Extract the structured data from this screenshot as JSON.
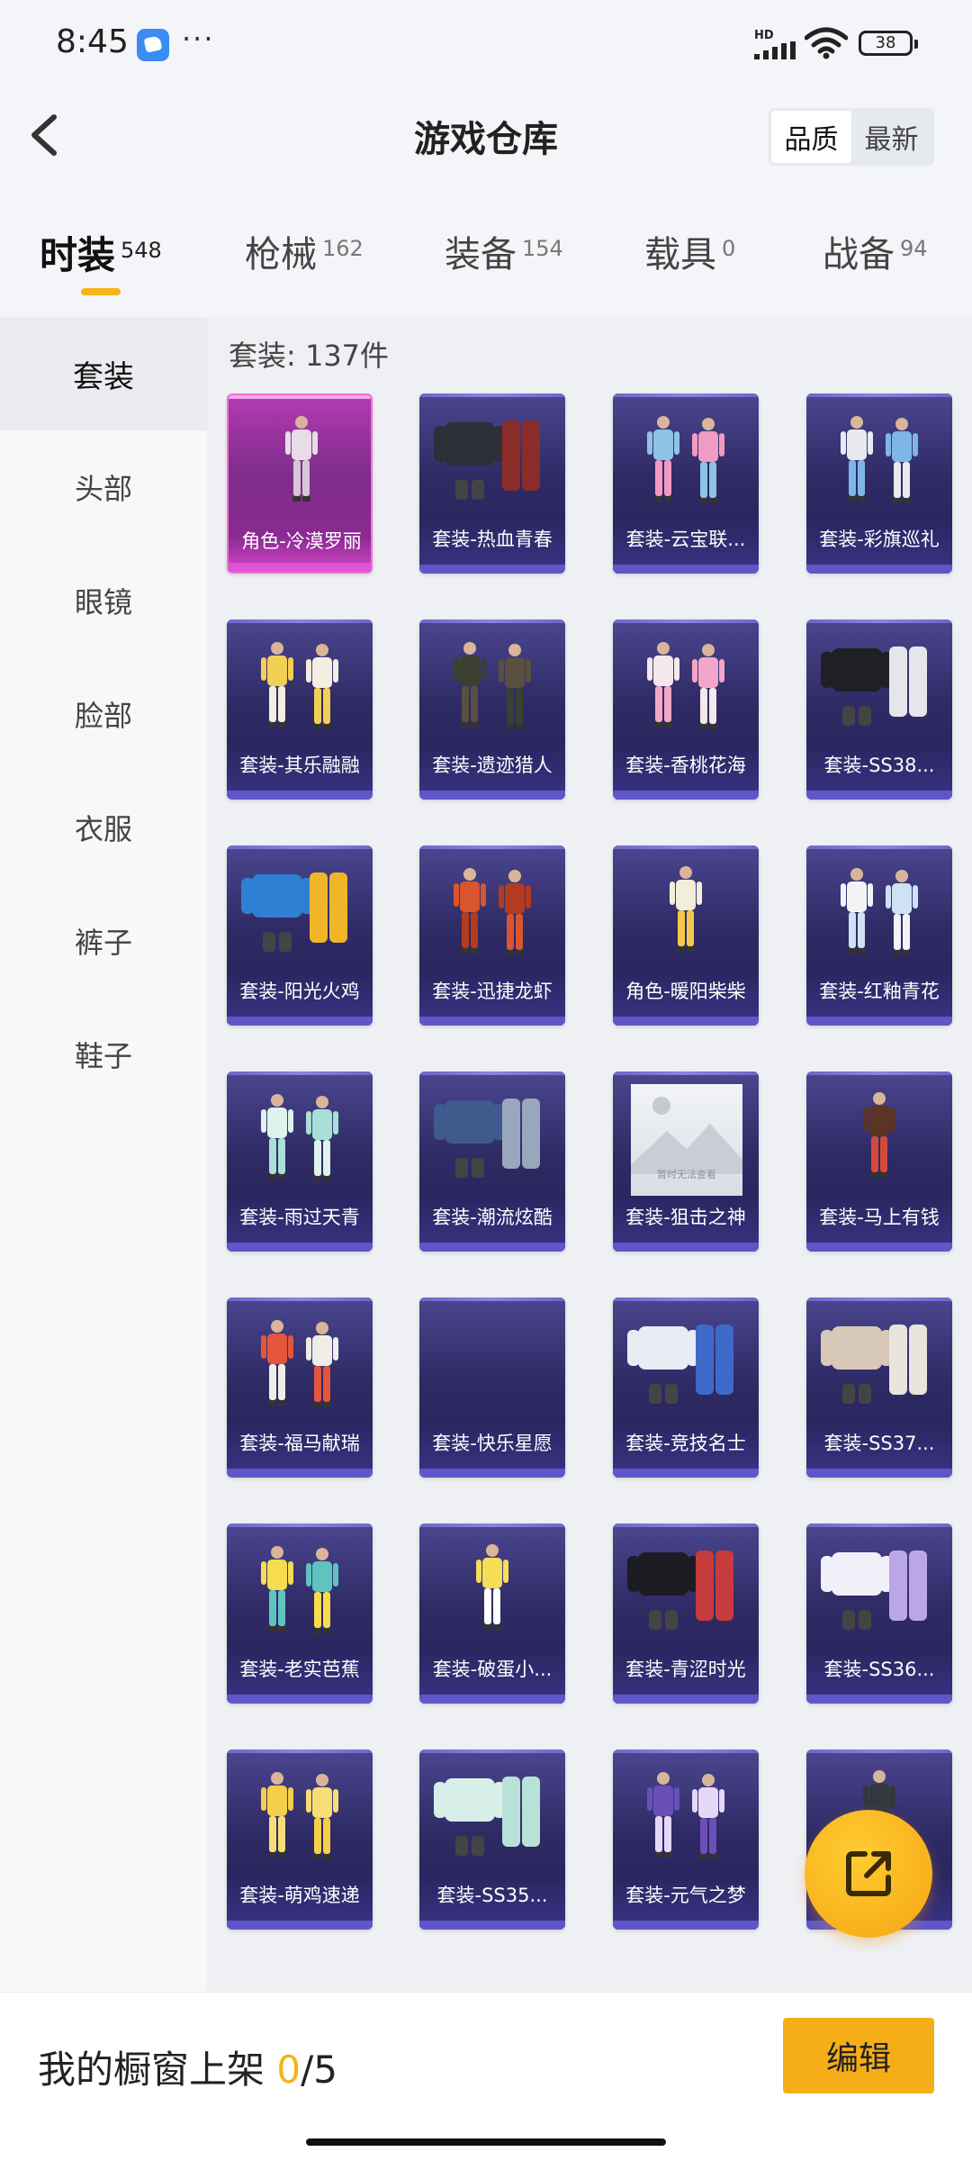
{
  "status_bar": {
    "time": "8:45",
    "more": "···",
    "network": "HD",
    "battery": "38",
    "icons": [
      "app-notification-icon",
      "signal-icon",
      "wifi-icon",
      "battery-icon"
    ]
  },
  "header": {
    "title": "游戏仓库",
    "sort_options": [
      {
        "label": "品质",
        "active": true
      },
      {
        "label": "最新",
        "active": false
      }
    ]
  },
  "tabs": [
    {
      "label": "时装",
      "count": "548",
      "active": true
    },
    {
      "label": "枪械",
      "count": "162",
      "active": false
    },
    {
      "label": "装备",
      "count": "154",
      "active": false
    },
    {
      "label": "载具",
      "count": "0",
      "active": false
    },
    {
      "label": "战备",
      "count": "94",
      "active": false
    }
  ],
  "sidebar": {
    "items": [
      {
        "label": "套装",
        "active": true
      },
      {
        "label": "头部",
        "active": false
      },
      {
        "label": "眼镜",
        "active": false
      },
      {
        "label": "脸部",
        "active": false
      },
      {
        "label": "衣服",
        "active": false
      },
      {
        "label": "裤子",
        "active": false
      },
      {
        "label": "鞋子",
        "active": false
      }
    ]
  },
  "main": {
    "count_label": "套装: 137件",
    "items": [
      {
        "label": "角色-冷漠罗丽",
        "rarity": "legendary",
        "colors": [
          "#e8dde6",
          "#d7c6d6"
        ],
        "style": "single"
      },
      {
        "label": "套装-热血青春",
        "rarity": "epic",
        "colors": [
          "#2d2f38",
          "#8a2c2a"
        ],
        "style": "outfit"
      },
      {
        "label": "套装-云宝联...",
        "rarity": "epic",
        "colors": [
          "#8ec3e6",
          "#f19ac4"
        ],
        "style": "pair"
      },
      {
        "label": "套装-彩旗巡礼",
        "rarity": "epic",
        "colors": [
          "#e9e9ef",
          "#7fb6e8"
        ],
        "style": "pair"
      },
      {
        "label": "套装-其乐融融",
        "rarity": "epic",
        "colors": [
          "#f3cf55",
          "#f3eee0"
        ],
        "style": "pair"
      },
      {
        "label": "套装-遗迹猎人",
        "rarity": "epic",
        "colors": [
          "#3b4032",
          "#59503f"
        ],
        "style": "pair"
      },
      {
        "label": "套装-香桃花海",
        "rarity": "epic",
        "colors": [
          "#f4e8ec",
          "#f4a6c8"
        ],
        "style": "pair"
      },
      {
        "label": "套装-SS38...",
        "rarity": "epic",
        "colors": [
          "#1f1f24",
          "#e6e6ea"
        ],
        "style": "outfit"
      },
      {
        "label": "套装-阳光火鸡",
        "rarity": "epic",
        "colors": [
          "#2f7fd4",
          "#f0b627"
        ],
        "style": "outfit"
      },
      {
        "label": "套装-迅捷龙虾",
        "rarity": "epic",
        "colors": [
          "#d9552f",
          "#b33b1f"
        ],
        "style": "pair"
      },
      {
        "label": "角色-暖阳柴柴",
        "rarity": "epic",
        "colors": [
          "#f2eedc",
          "#f3c94c"
        ],
        "style": "single"
      },
      {
        "label": "套装-红釉青花",
        "rarity": "epic",
        "colors": [
          "#f3f3f6",
          "#cfe1f4"
        ],
        "style": "pair"
      },
      {
        "label": "套装-雨过天青",
        "rarity": "epic",
        "colors": [
          "#dff3ee",
          "#a9e0d6"
        ],
        "style": "pair"
      },
      {
        "label": "套装-潮流炫酷",
        "rarity": "epic",
        "colors": [
          "#3f5a8d",
          "#9aa6bc"
        ],
        "style": "outfit"
      },
      {
        "label": "套装-狙击之神",
        "rarity": "epic",
        "placeholder": true,
        "placeholder_text": "暂时无法查看"
      },
      {
        "label": "套装-马上有钱",
        "rarity": "epic",
        "colors": [
          "#5a3424",
          "#d34a3a"
        ],
        "style": "single"
      },
      {
        "label": "套装-福马献瑞",
        "rarity": "epic",
        "colors": [
          "#e4553d",
          "#f0ede6"
        ],
        "style": "pair"
      },
      {
        "label": "套装-快乐星愿",
        "rarity": "epic",
        "empty": true
      },
      {
        "label": "套装-竞技名士",
        "rarity": "epic",
        "colors": [
          "#e8ecf5",
          "#3e69c9"
        ],
        "style": "outfit"
      },
      {
        "label": "套装-SS37...",
        "rarity": "epic",
        "colors": [
          "#d8c8b8",
          "#e9e4dc"
        ],
        "style": "outfit"
      },
      {
        "label": "套装-老实芭蕉",
        "rarity": "epic",
        "colors": [
          "#f6dc4e",
          "#5fc4c0"
        ],
        "style": "pair"
      },
      {
        "label": "套装-破蛋小...",
        "rarity": "epic",
        "colors": [
          "#f6de55",
          "#ffffff"
        ],
        "style": "single"
      },
      {
        "label": "套装-青涩时光",
        "rarity": "epic",
        "colors": [
          "#1c1c22",
          "#c63b3b"
        ],
        "style": "outfit"
      },
      {
        "label": "套装-SS36...",
        "rarity": "epic",
        "colors": [
          "#f1f0f8",
          "#bba6e6"
        ],
        "style": "outfit"
      },
      {
        "label": "套装-萌鸡速递",
        "rarity": "epic",
        "colors": [
          "#f5cf4a",
          "#f7dd75"
        ],
        "style": "pair"
      },
      {
        "label": "套装-SS35...",
        "rarity": "epic",
        "colors": [
          "#d8efe9",
          "#b8e2d8"
        ],
        "style": "outfit"
      },
      {
        "label": "套装-元气之梦",
        "rarity": "epic",
        "colors": [
          "#6b4fb7",
          "#e5d7f7"
        ],
        "style": "pair"
      },
      {
        "label": "",
        "rarity": "epic",
        "colors": [
          "#34383e",
          "#a06a3a"
        ],
        "style": "single"
      }
    ]
  },
  "share_button": {
    "icon": "share-external-icon"
  },
  "bottom_bar": {
    "window_label": "我的橱窗上架 ",
    "window_current": "0",
    "window_total": "/5",
    "edit_label": "编辑"
  },
  "colors": {
    "accent": "#f5b21a",
    "legendary": "#d546c7",
    "epic": "#3a3386"
  }
}
